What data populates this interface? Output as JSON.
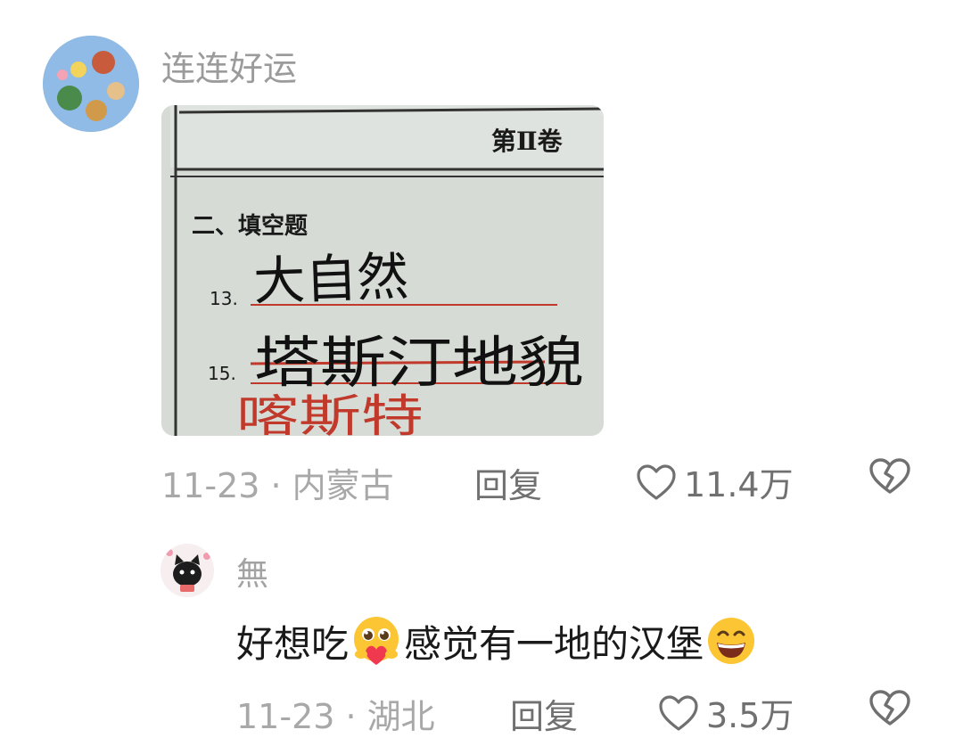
{
  "comment": {
    "username": "连连好运",
    "photo": {
      "header": "第Ⅱ卷",
      "section": "二、填空题",
      "q13_number": "13.",
      "q13_answer": "大自然",
      "q15_number": "15.",
      "q15_answer": "塔斯汀地貌",
      "q15_correction": "喀斯特"
    },
    "date": "11-23",
    "location": "内蒙古",
    "meta_sep": " · ",
    "reply_label": "回复",
    "like_count": "11.4万"
  },
  "reply": {
    "username": "無",
    "text_part1": "好想吃",
    "text_part2": "感觉有一地的汉堡",
    "date": "11-23",
    "location": "湖北",
    "meta_sep": " · ",
    "reply_label": "回复",
    "like_count": "3.5万"
  },
  "icons": {
    "like": "heart-outline-icon",
    "dislike": "broken-heart-icon",
    "emoji1": "pleading-face-holding-heart",
    "emoji2": "grinning-face"
  },
  "colors": {
    "meta_text": "#a8a8a8",
    "action_text": "#707070",
    "body_text": "#1a1a1a",
    "ink_red": "#c0392b"
  }
}
